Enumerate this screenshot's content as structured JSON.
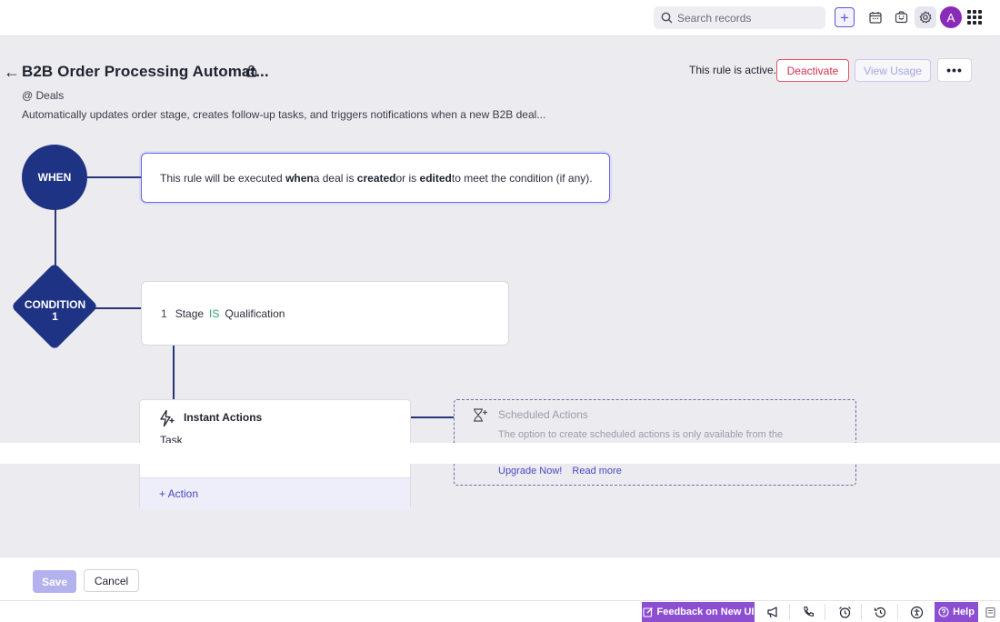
{
  "topbar": {
    "search_placeholder": "Search records",
    "avatar_initial": "A"
  },
  "header": {
    "title": "B2B Order Processing Automat...",
    "module": "@ Deals",
    "description": "Automatically updates order stage, creates follow-up tasks, and triggers notifications when a new B2B deal...",
    "status_text": "This rule is active.",
    "deactivate_label": "Deactivate",
    "view_usage_label": "View Usage",
    "more_label": "•••"
  },
  "flow": {
    "when_label": "WHEN",
    "when_text": {
      "part1": "This rule will be executed ",
      "bold1": "when",
      "part2": " a deal is ",
      "bold2": "created",
      "part3": " or is ",
      "bold3": "edited",
      "part4": " to meet the condition (if any)."
    },
    "condition_label_line1": "CONDITION",
    "condition_label_line2": "1",
    "condition": {
      "index": "1",
      "field": "Stage",
      "operator": "IS",
      "value": "Qualification"
    },
    "instant_actions": {
      "title": "Instant Actions",
      "item": "Task",
      "add_action": "+ Action"
    },
    "scheduled_actions": {
      "title": "Scheduled Actions",
      "text": "The option to create scheduled actions is only available from the",
      "upgrade": "Upgrade Now!",
      "read_more": "Read more"
    }
  },
  "footer": {
    "save_label": "Save",
    "cancel_label": "Cancel"
  },
  "statusbar": {
    "feedback_label": "Feedback on New UI",
    "help_label": "Help"
  },
  "colors": {
    "primary_dark": "#1e3383",
    "accent": "#5b57d6",
    "danger": "#d42f4b",
    "feedback_purple": "#8c4fcf"
  }
}
